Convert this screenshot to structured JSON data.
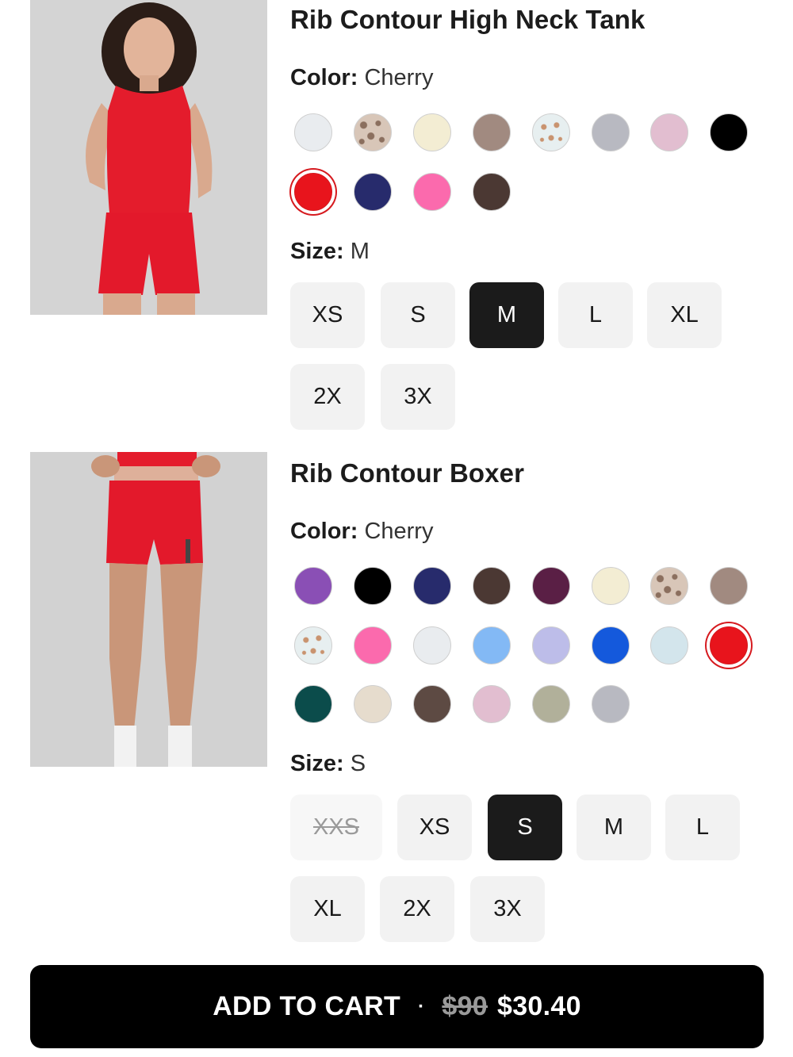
{
  "products": [
    {
      "title": "Rib Contour High Neck Tank",
      "color_label": "Color",
      "color_value": "Cherry",
      "size_label": "Size",
      "size_value": "M",
      "swatches": [
        {
          "name": "white",
          "color": "#e9ecef"
        },
        {
          "name": "leopard",
          "color": "#d8c6b8",
          "pattern": "leopard"
        },
        {
          "name": "cream",
          "color": "#f3edd3"
        },
        {
          "name": "mocha",
          "color": "#a18a80"
        },
        {
          "name": "hearts",
          "color": "#e7eff0",
          "pattern": "hearts"
        },
        {
          "name": "gray",
          "color": "#b8b9c1"
        },
        {
          "name": "pink",
          "color": "#e2bed0"
        },
        {
          "name": "black",
          "color": "#000000"
        },
        {
          "name": "cherry",
          "color": "#e8141c",
          "selected": true
        },
        {
          "name": "navy",
          "color": "#272b6c"
        },
        {
          "name": "hot-pink",
          "color": "#fb6aad"
        },
        {
          "name": "espresso",
          "color": "#4b3833"
        }
      ],
      "sizes": [
        {
          "label": "XS"
        },
        {
          "label": "S"
        },
        {
          "label": "M",
          "selected": true
        },
        {
          "label": "L"
        },
        {
          "label": "XL"
        },
        {
          "label": "2X"
        },
        {
          "label": "3X"
        }
      ]
    },
    {
      "title": "Rib Contour Boxer",
      "color_label": "Color",
      "color_value": "Cherry",
      "size_label": "Size",
      "size_value": "S",
      "swatches": [
        {
          "name": "purple",
          "color": "#8a4fb5"
        },
        {
          "name": "black",
          "color": "#000000"
        },
        {
          "name": "navy",
          "color": "#272b6c"
        },
        {
          "name": "espresso",
          "color": "#4b3833"
        },
        {
          "name": "plum",
          "color": "#5a1f45"
        },
        {
          "name": "cream",
          "color": "#f3edd3"
        },
        {
          "name": "leopard",
          "color": "#d8c6b8",
          "pattern": "leopard"
        },
        {
          "name": "mocha",
          "color": "#a18a80"
        },
        {
          "name": "hearts",
          "color": "#e7eff0",
          "pattern": "hearts"
        },
        {
          "name": "hot-pink",
          "color": "#fb6aad"
        },
        {
          "name": "white",
          "color": "#e9ecef"
        },
        {
          "name": "sky-blue",
          "color": "#83b9f5"
        },
        {
          "name": "lavender",
          "color": "#bdbde9"
        },
        {
          "name": "royal-blue",
          "color": "#1459dc"
        },
        {
          "name": "ice-blue",
          "color": "#d3e5ec"
        },
        {
          "name": "cherry",
          "color": "#e8141c",
          "selected": true
        },
        {
          "name": "teal",
          "color": "#0b4c4b"
        },
        {
          "name": "sand",
          "color": "#e6dccd"
        },
        {
          "name": "brown",
          "color": "#5d4a43"
        },
        {
          "name": "light-pink",
          "color": "#e2bed0"
        },
        {
          "name": "sage",
          "color": "#b1b09a"
        },
        {
          "name": "gray",
          "color": "#b8b9c1"
        }
      ],
      "sizes": [
        {
          "label": "XXS",
          "disabled": true
        },
        {
          "label": "XS"
        },
        {
          "label": "S",
          "selected": true
        },
        {
          "label": "M"
        },
        {
          "label": "L"
        },
        {
          "label": "XL"
        },
        {
          "label": "2X"
        },
        {
          "label": "3X"
        }
      ]
    }
  ],
  "cart": {
    "label": "ADD TO CART",
    "separator": "·",
    "original_price": "$90",
    "price": "$30.40"
  },
  "colors": {
    "primary": "#000000",
    "selected_ring": "#d61a1f",
    "size_bg": "#f2f2f2",
    "size_selected_bg": "#1b1b1b"
  }
}
